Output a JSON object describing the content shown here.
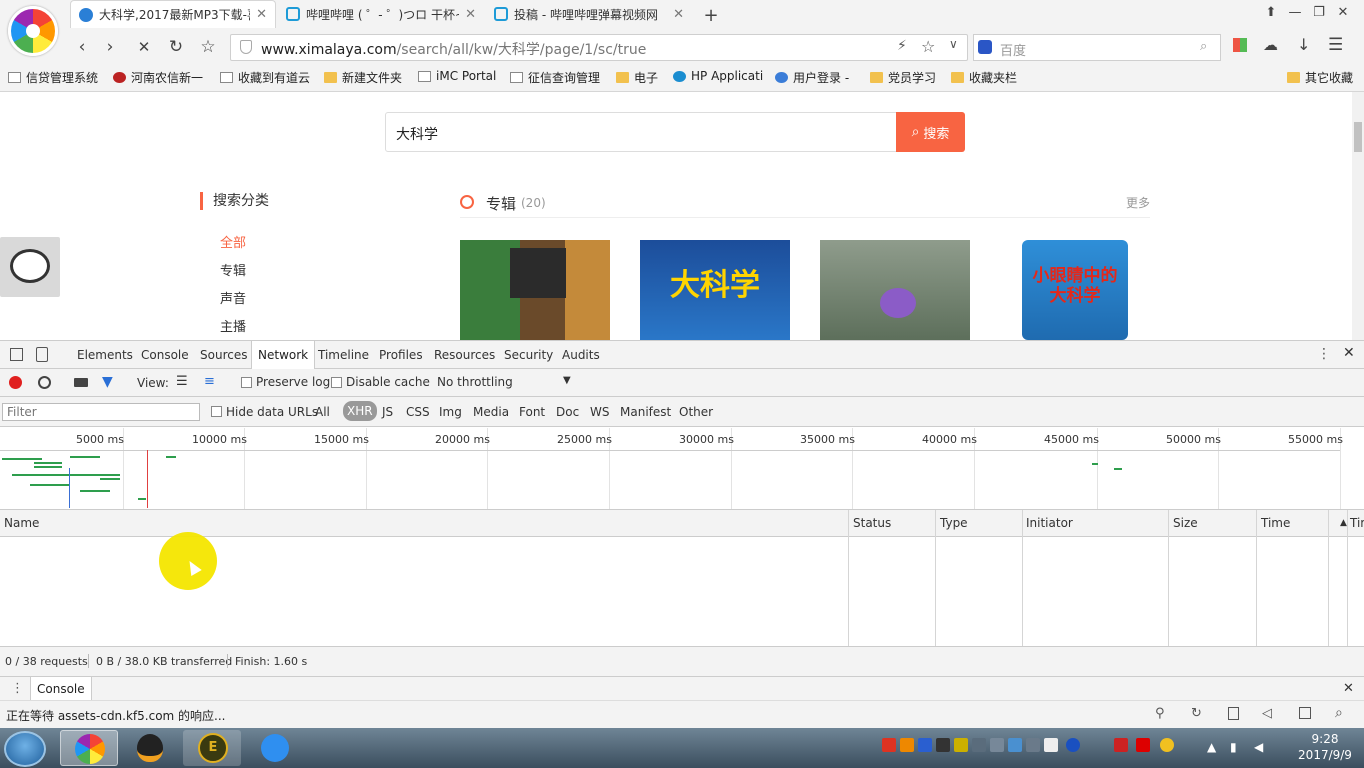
{
  "browser": {
    "tabs": [
      {
        "title": "大科学,2017最新MP3下载-喜",
        "active": true
      },
      {
        "title": "哔哩哔哩 ( ゜- ゜)つロ 干杯~",
        "active": false
      },
      {
        "title": "投稿 - 哔哩哔哩弹幕视频网",
        "active": false
      }
    ],
    "url_domain": "www.ximalaya.com",
    "url_path": "/search/all/kw/大科学/page/1/sc/true",
    "search_placeholder": "百度",
    "bookmarks": [
      {
        "label": "信贷管理系统",
        "icon": "page-icon"
      },
      {
        "label": "河南农信新一",
        "icon": "site-icon"
      },
      {
        "label": "收藏到有道云",
        "icon": "page-icon"
      },
      {
        "label": "新建文件夹",
        "icon": "folder-icon"
      },
      {
        "label": "iMC Portal",
        "icon": "page-icon"
      },
      {
        "label": "征信查询管理",
        "icon": "page-icon"
      },
      {
        "label": "电子",
        "icon": "folder-icon"
      },
      {
        "label": "HP Applicati",
        "icon": "site-icon"
      },
      {
        "label": "用户登录 -",
        "icon": "globe-icon"
      },
      {
        "label": "党员学习",
        "icon": "folder-icon"
      },
      {
        "label": "收藏夹栏",
        "icon": "folder-icon"
      }
    ],
    "other_bookmarks": "其它收藏"
  },
  "page": {
    "search_value": "大科学",
    "search_button": "搜索",
    "category_title": "搜索分类",
    "categories": [
      "全部",
      "专辑",
      "声音",
      "主播"
    ],
    "album_heading": "专辑",
    "album_count": "(20)",
    "more": "更多",
    "brand_color": "#f86442",
    "cover_texts": [
      "",
      "大科学",
      "",
      "小眼睛中的大科学"
    ]
  },
  "devtools": {
    "tabs": [
      "Elements",
      "Console",
      "Sources",
      "Network",
      "Timeline",
      "Profiles",
      "Resources",
      "Security",
      "Audits"
    ],
    "active_tab": "Network",
    "toolbar": {
      "view_label": "View:",
      "preserve_log": "Preserve log",
      "disable_cache": "Disable cache",
      "throttling": "No throttling"
    },
    "filter_placeholder": "Filter",
    "hide_data_urls": "Hide data URLs",
    "types": [
      "All",
      "XHR",
      "JS",
      "CSS",
      "Img",
      "Media",
      "Font",
      "Doc",
      "WS",
      "Manifest",
      "Other"
    ],
    "active_type": "XHR",
    "timeline_ticks": [
      "5000 ms",
      "10000 ms",
      "15000 ms",
      "20000 ms",
      "25000 ms",
      "30000 ms",
      "35000 ms",
      "40000 ms",
      "45000 ms",
      "50000 ms",
      "55000 ms"
    ],
    "columns": [
      "Name",
      "Status",
      "Type",
      "Initiator",
      "Size",
      "Time",
      "Tim"
    ],
    "summary": {
      "requests": "0 / 38 requests",
      "transferred": "0 B / 38.0 KB transferred",
      "finish": "Finish: 1.60 s"
    },
    "drawer_tab": "Console"
  },
  "statusbar": {
    "text": "正在等待 assets-cdn.kf5.com 的响应..."
  },
  "taskbar": {
    "time": "9:28",
    "date": "2017/9/9"
  }
}
